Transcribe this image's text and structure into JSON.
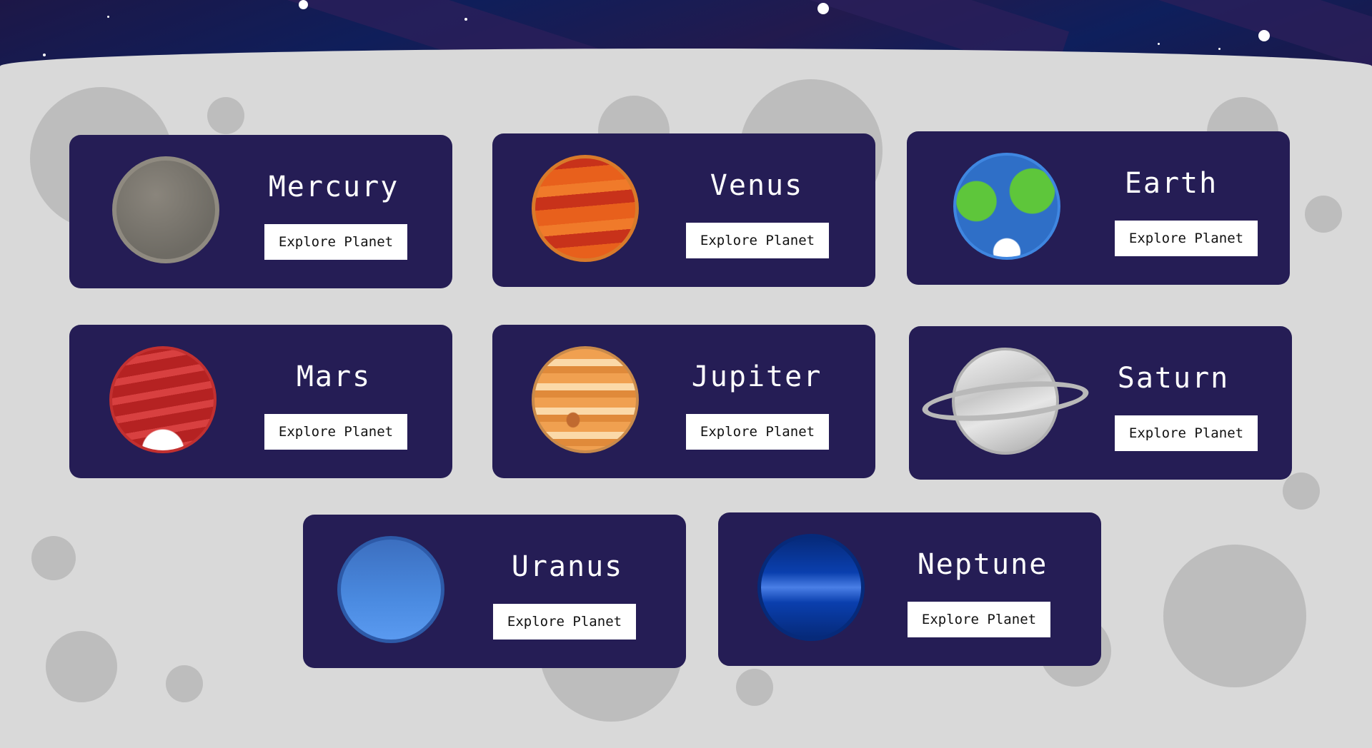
{
  "planets": [
    {
      "name": "Mercury",
      "button_label": "Explore Planet",
      "colors": {
        "base": "#6e6b64",
        "accent": "#8a857c",
        "rim": "#9a958c"
      }
    },
    {
      "name": "Venus",
      "button_label": "Explore Planet",
      "colors": {
        "base": "#e8601c",
        "accent": "#c8321a",
        "rim": "#d97a2a"
      }
    },
    {
      "name": "Earth",
      "button_label": "Explore Planet",
      "colors": {
        "base": "#2f6fc7",
        "accent": "#5ec63b",
        "rim": "#ffffff"
      }
    },
    {
      "name": "Mars",
      "button_label": "Explore Planet",
      "colors": {
        "base": "#b52222",
        "accent": "#d84040",
        "rim": "#ffffff"
      }
    },
    {
      "name": "Jupiter",
      "button_label": "Explore Planet",
      "colors": {
        "base": "#f0a050",
        "accent": "#fbd9a8",
        "rim": "#c98a4a"
      }
    },
    {
      "name": "Saturn",
      "button_label": "Explore Planet",
      "colors": {
        "base": "#c8c8c8",
        "accent": "#f2f2f2",
        "rim": "#9b9b9b"
      }
    },
    {
      "name": "Uranus",
      "button_label": "Explore Planet",
      "colors": {
        "base": "#4a8ae0",
        "accent": "#3c6fc0",
        "rim": "#2d5aa8"
      }
    },
    {
      "name": "Neptune",
      "button_label": "Explore Planet",
      "colors": {
        "base": "#0a3fae",
        "accent": "#4a7fe6",
        "rim": "#062a7a"
      }
    }
  ],
  "theme": {
    "card": "#251d55",
    "ground": "#d9d9d9",
    "crater": "#bdbdbd"
  }
}
